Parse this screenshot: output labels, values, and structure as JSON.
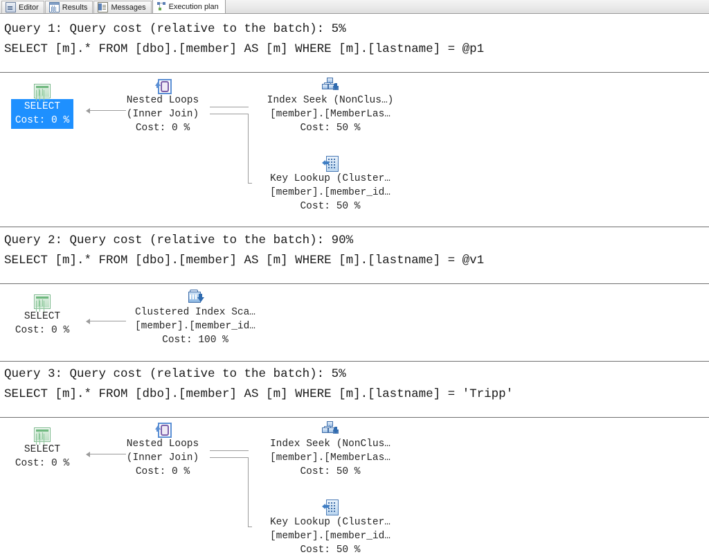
{
  "tabs": [
    {
      "label": "Editor",
      "icon": "editor-icon",
      "active": false
    },
    {
      "label": "Results",
      "icon": "results-grid-icon",
      "active": false
    },
    {
      "label": "Messages",
      "icon": "messages-icon",
      "active": false
    },
    {
      "label": "Execution plan",
      "icon": "execution-plan-icon",
      "active": true
    }
  ],
  "queries": [
    {
      "header": "Query 1: Query cost (relative to the batch): 5%",
      "sql": "SELECT [m].* FROM [dbo].[member] AS [m] WHERE [m].[lastname] = @p1",
      "nodes": {
        "select": {
          "line1": "SELECT",
          "line2": "Cost: 0 %",
          "line3": "",
          "icon": "select-result-icon",
          "selected": true
        },
        "loops": {
          "line1": "Nested Loops",
          "line2": "(Inner Join)",
          "line3": "Cost: 0 %",
          "icon": "nested-loops-icon"
        },
        "seek": {
          "line1": "Index Seek (NonClus…)",
          "line2": "[member].[MemberLas…",
          "line3": "Cost: 50 %",
          "icon": "index-seek-icon"
        },
        "lookup": {
          "line1": "Key Lookup (Cluster…",
          "line2": "[member].[member_id…",
          "line3": "Cost: 50 %",
          "icon": "key-lookup-icon"
        }
      }
    },
    {
      "header": "Query 2: Query cost (relative to the batch): 90%",
      "sql": "SELECT [m].* FROM [dbo].[member] AS [m] WHERE [m].[lastname] = @v1",
      "nodes": {
        "select": {
          "line1": "SELECT",
          "line2": "Cost: 0 %",
          "line3": "",
          "icon": "select-result-icon",
          "selected": false
        },
        "scan": {
          "line1": "Clustered Index Sca…",
          "line2": "[member].[member_id…",
          "line3": "Cost: 100 %",
          "icon": "clustered-index-scan-icon"
        }
      }
    },
    {
      "header": "Query 3: Query cost (relative to the batch): 5%",
      "sql": "SELECT [m].* FROM [dbo].[member] AS [m] WHERE [m].[lastname] = 'Tripp'",
      "nodes": {
        "select": {
          "line1": "SELECT",
          "line2": "Cost: 0 %",
          "line3": "",
          "icon": "select-result-icon",
          "selected": false
        },
        "loops": {
          "line1": "Nested Loops",
          "line2": "(Inner Join)",
          "line3": "Cost: 0 %",
          "icon": "nested-loops-icon"
        },
        "seek": {
          "line1": "Index Seek (NonClus…",
          "line2": "[member].[MemberLas…",
          "line3": "Cost: 50 %",
          "icon": "index-seek-icon"
        },
        "lookup": {
          "line1": "Key Lookup (Cluster…",
          "line2": "[member].[member_id…",
          "line3": "Cost: 50 %",
          "icon": "key-lookup-icon"
        }
      }
    }
  ],
  "colors": {
    "selection_blue": "#1e90ff",
    "connector_gray": "#9b9b9b",
    "separator_gray": "#6f6f6f",
    "text": "#1a1a1a",
    "canvas_bg": "#ffffff"
  }
}
